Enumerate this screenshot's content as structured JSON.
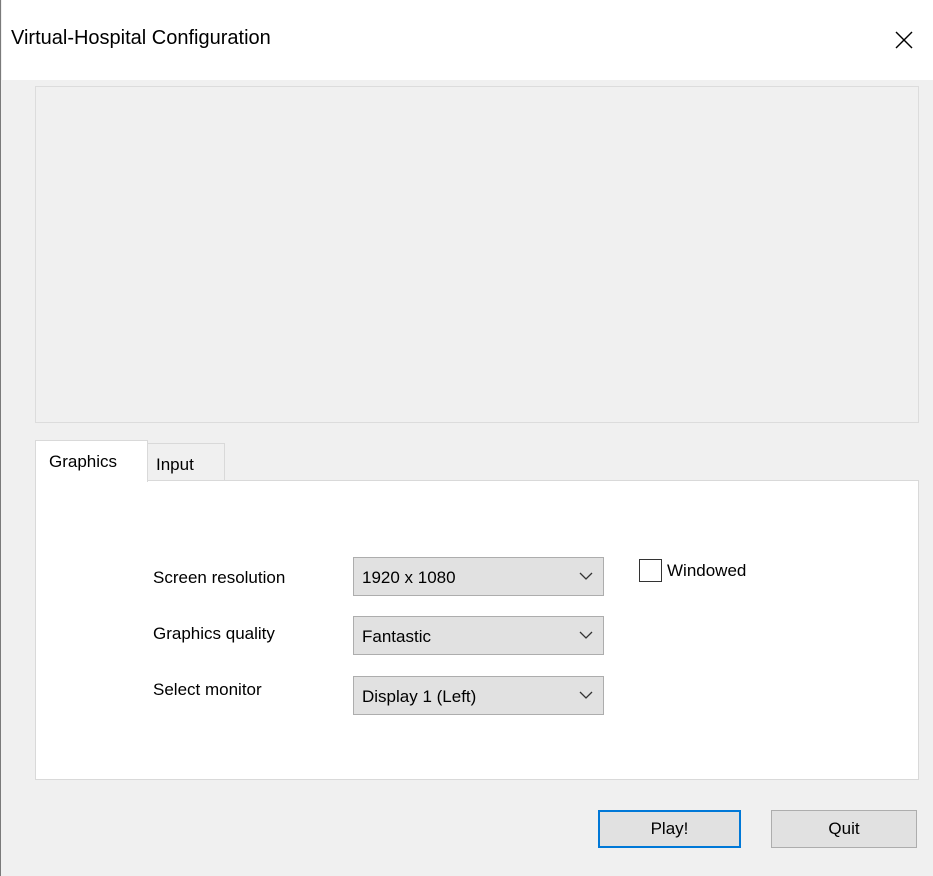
{
  "window": {
    "title": "Virtual-Hospital Configuration",
    "close_icon": "close-icon"
  },
  "tabs": [
    {
      "label": "Graphics",
      "active": true
    },
    {
      "label": "Input",
      "active": false
    }
  ],
  "graphics": {
    "resolution": {
      "label": "Screen resolution",
      "value": "1920 x 1080"
    },
    "quality": {
      "label": "Graphics quality",
      "value": "Fantastic"
    },
    "monitor": {
      "label": "Select monitor",
      "value": "Display 1 (Left)"
    },
    "windowed": {
      "label": "Windowed",
      "checked": false
    }
  },
  "buttons": {
    "play": "Play!",
    "quit": "Quit"
  },
  "colors": {
    "focus_border": "#0078d7",
    "button_bg": "#e1e1e1",
    "window_bg": "#f0f0f0"
  }
}
